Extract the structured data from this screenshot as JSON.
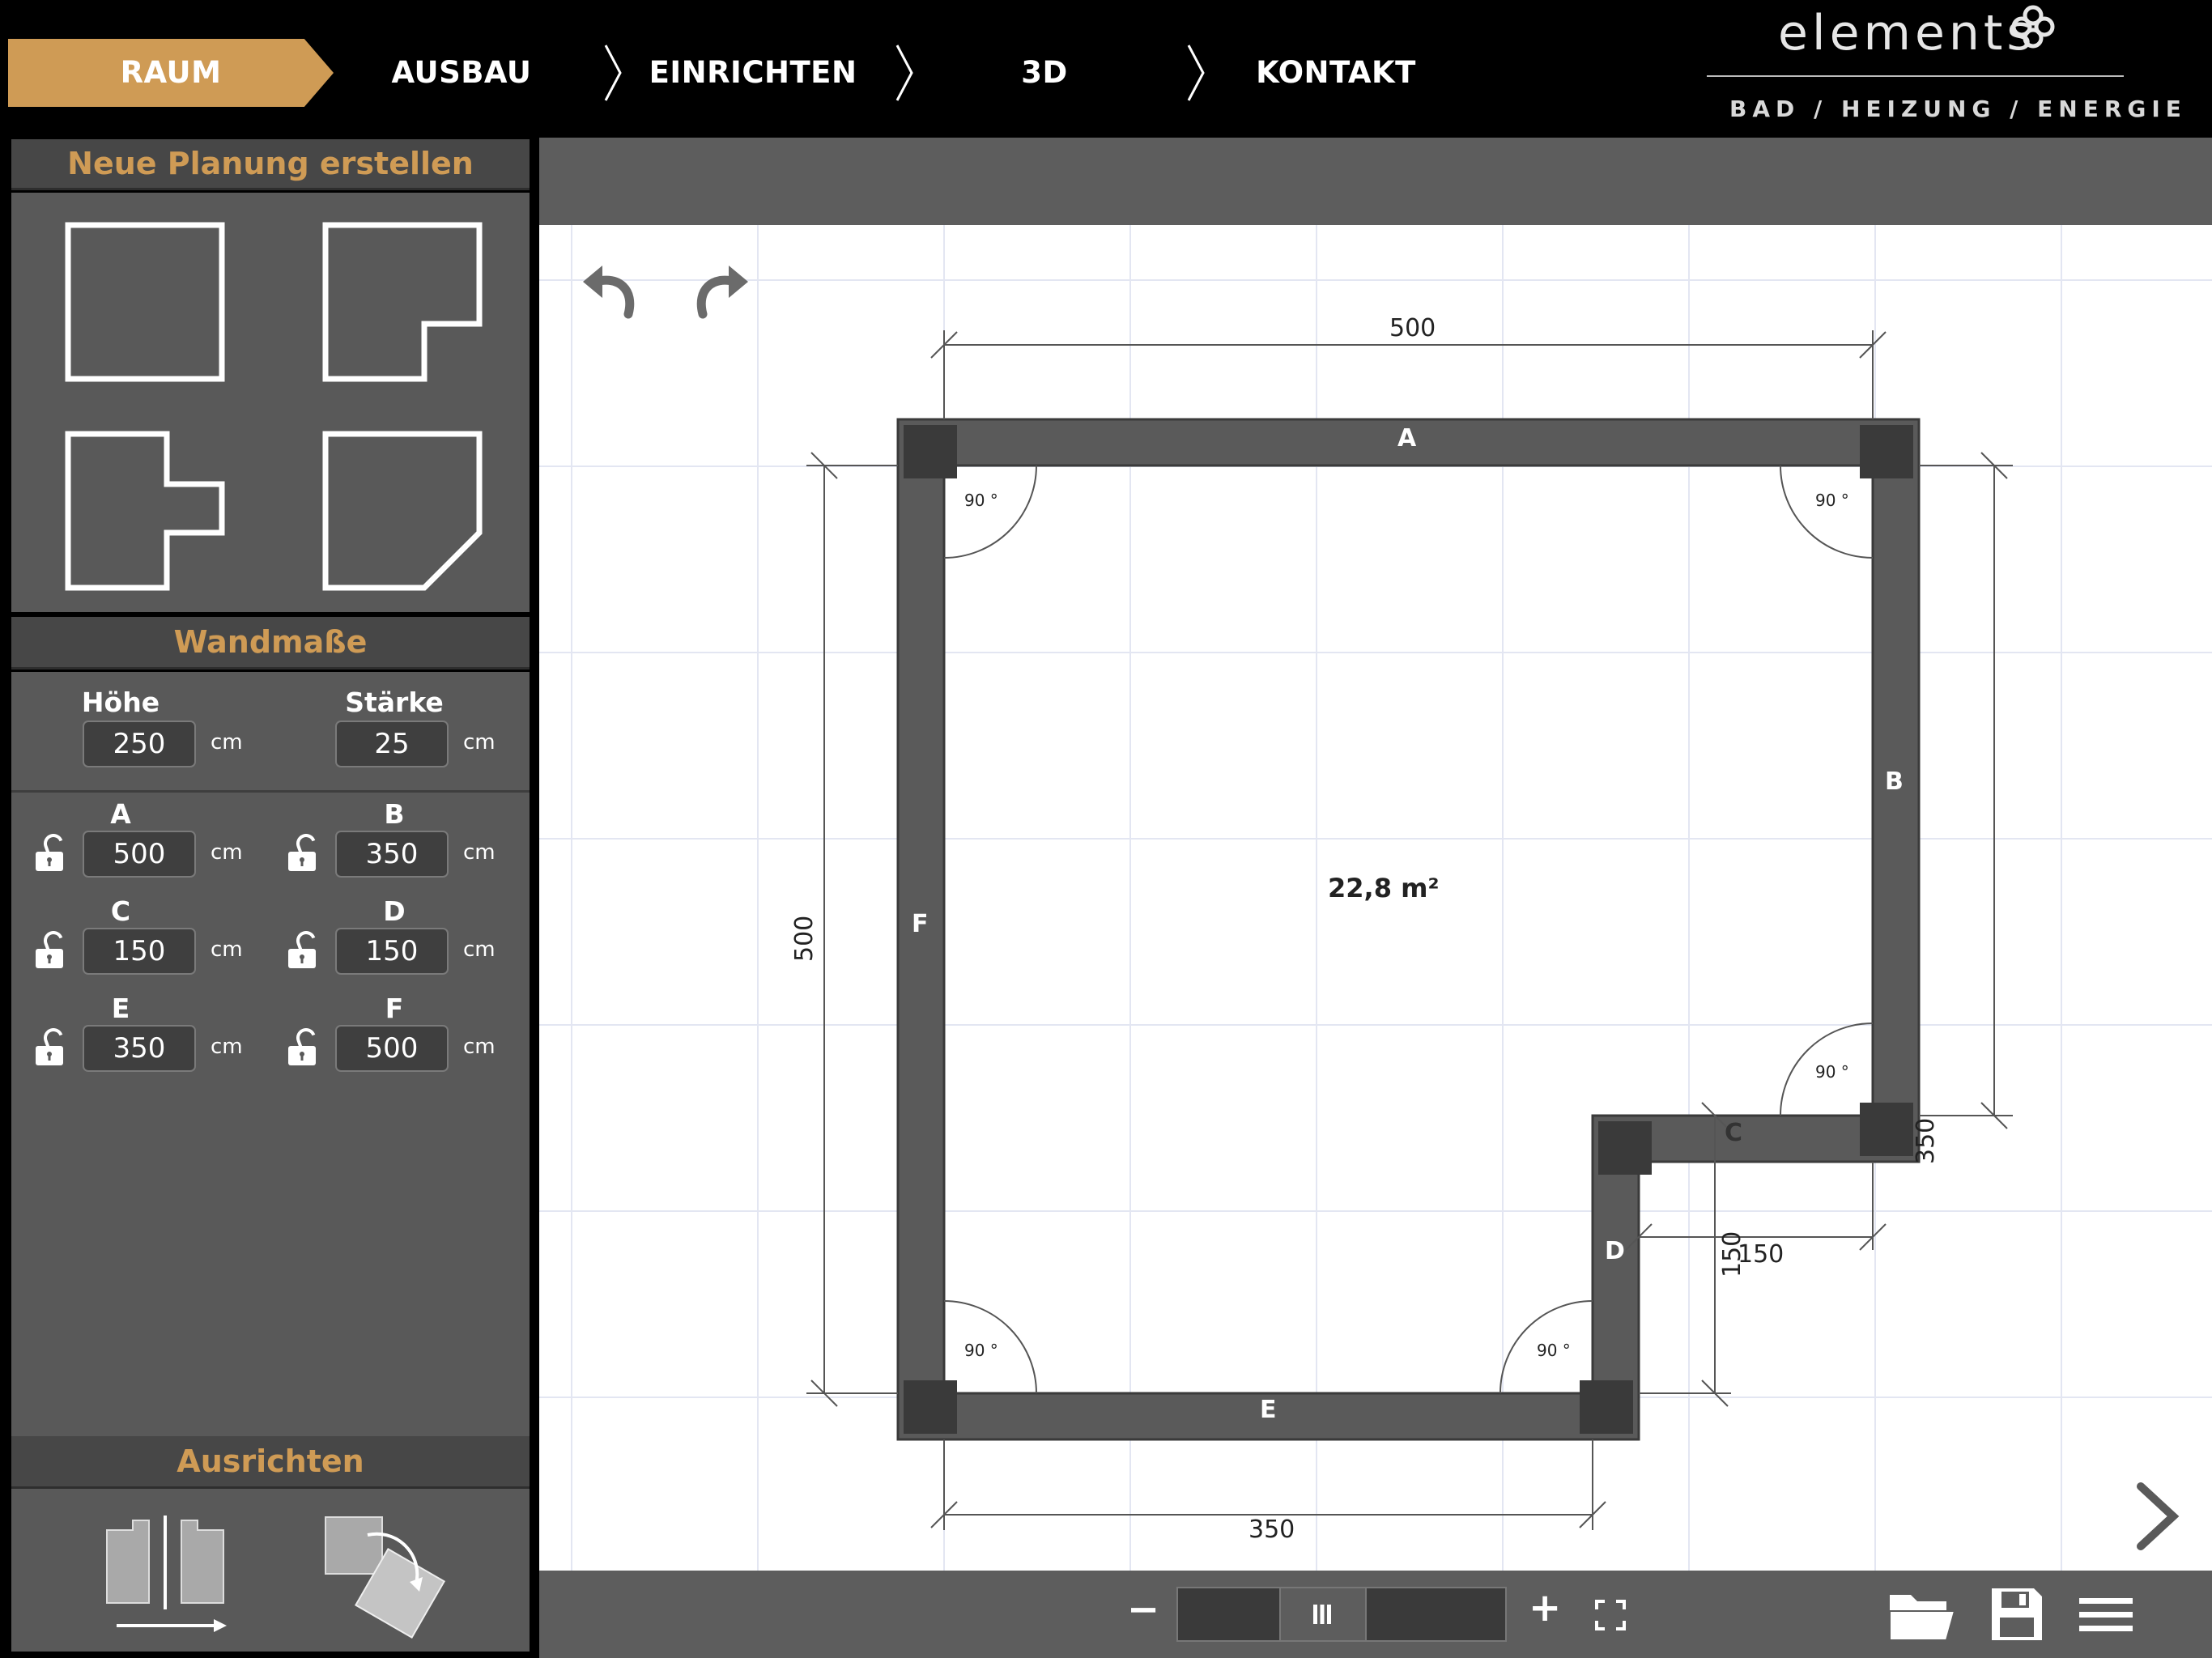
{
  "nav": {
    "steps": [
      {
        "label": "RAUM",
        "active": true
      },
      {
        "label": "AUSBAU",
        "active": false
      },
      {
        "label": "EINRICHTEN",
        "active": false
      },
      {
        "label": "3D",
        "active": false
      },
      {
        "label": "KONTAKT",
        "active": false
      }
    ]
  },
  "logo": {
    "word": "elements",
    "subtitle": "BAD / HEIZUNG / ENERGIE"
  },
  "colors": {
    "accent": "#cf9b55",
    "panel": "#595959",
    "panel_head": "#474747",
    "wall": "#5a5a5a",
    "corner": "#3a3a3a"
  },
  "panel": {
    "new_plan_title": "Neue Planung erstellen",
    "shapes": [
      "rectangle-room-icon",
      "l-shape-room-icon",
      "t-shape-room-icon",
      "chamfer-room-icon"
    ],
    "wall_title": "Wandmaße",
    "height_label": "Höhe",
    "height_value": "250",
    "thickness_label": "Stärke",
    "thickness_value": "25",
    "unit": "cm",
    "walls": [
      {
        "label": "A",
        "value": "500"
      },
      {
        "label": "B",
        "value": "350"
      },
      {
        "label": "C",
        "value": "150"
      },
      {
        "label": "D",
        "value": "150"
      },
      {
        "label": "E",
        "value": "350"
      },
      {
        "label": "F",
        "value": "500"
      }
    ],
    "align_title": "Ausrichten"
  },
  "plan": {
    "area": "22,8 m²",
    "walls": {
      "A": "A",
      "B": "B",
      "C": "C",
      "D": "D",
      "E": "E",
      "F": "F"
    },
    "dims": {
      "top": "500",
      "right": "350",
      "left": "500",
      "bottom": "350",
      "notch": "150",
      "notch_v": "150"
    },
    "angle": "90 °"
  },
  "toolbar": {
    "zoom_out": "−",
    "zoom_in": "+"
  }
}
